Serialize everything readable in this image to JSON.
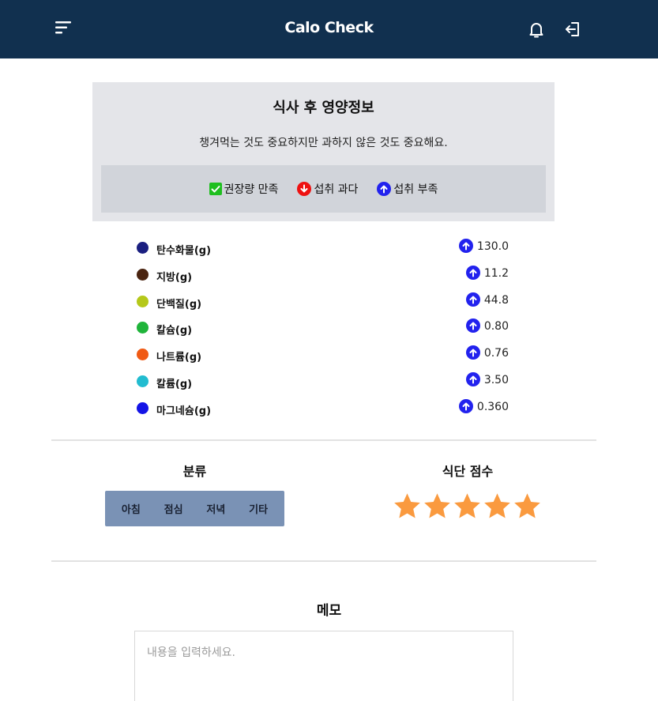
{
  "header": {
    "title": "Calo Check",
    "menu_icon": "menu-icon",
    "bell_icon": "bell-icon",
    "logout_icon": "logout-icon",
    "background": "#11304f"
  },
  "info": {
    "title": "식사 후 영양정보",
    "subtitle": "챙겨먹는 것도 중요하지만 과하지 않은 것도 중요해요.",
    "legend": [
      {
        "label": "권장량 만족",
        "icon": "check-icon",
        "color": "#1fbf1f"
      },
      {
        "label": "섭취 과다",
        "icon": "arrow-down-icon",
        "color": "#ee1111"
      },
      {
        "label": "섭취 부족",
        "icon": "arrow-up-icon",
        "color": "#2222ee"
      }
    ]
  },
  "nutrients": [
    {
      "name": "탄수화물(g)",
      "value": "130.0",
      "color": "#1a1f80",
      "status": "arrow-up-icon"
    },
    {
      "name": "지방(g)",
      "value": "11.2",
      "color": "#4a2410",
      "status": "arrow-up-icon"
    },
    {
      "name": "단백질(g)",
      "value": "44.8",
      "color": "#b5c81a",
      "status": "arrow-up-icon"
    },
    {
      "name": "칼슘(g)",
      "value": "0.80",
      "color": "#1fb43a",
      "status": "arrow-up-icon"
    },
    {
      "name": "나트륨(g)",
      "value": "0.76",
      "color": "#f05a14",
      "status": "arrow-up-icon"
    },
    {
      "name": "칼륨(g)",
      "value": "3.50",
      "color": "#22bcd0",
      "status": "arrow-up-icon"
    },
    {
      "name": "마그네슘(g)",
      "value": "0.360",
      "color": "#1414e6",
      "status": "arrow-up-icon"
    }
  ],
  "category": {
    "title": "분류",
    "tabs": [
      "아침",
      "점심",
      "저녁",
      "기타"
    ]
  },
  "score": {
    "title": "식단 점수",
    "rating": 5,
    "max": 5,
    "star_color": "#fa9a3f"
  },
  "memo": {
    "title": "메모",
    "placeholder": "내용을 입력하세요.",
    "value": ""
  }
}
